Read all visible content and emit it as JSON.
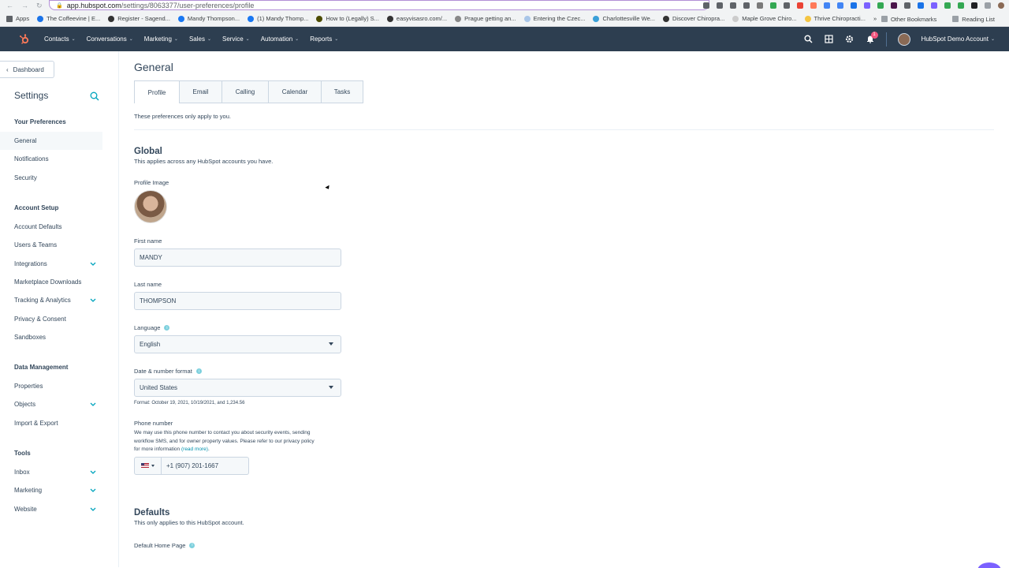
{
  "browser": {
    "url_host": "app.hubspot.com",
    "url_path": "/settings/8063377/user-preferences/profile",
    "bookmarks": [
      {
        "label": "Apps",
        "color": "#5f6368"
      },
      {
        "label": "The Coffeevine | E...",
        "color": "#1a73e8"
      },
      {
        "label": "Register - Sagend...",
        "color": "#333333"
      },
      {
        "label": "Mandy Thompson...",
        "color": "#1877f2"
      },
      {
        "label": "(1) Mandy Thomp...",
        "color": "#1877f2"
      },
      {
        "label": "How to (Legally) S...",
        "color": "#4c4c00"
      },
      {
        "label": "easyvisasro.com/...",
        "color": "#333333"
      },
      {
        "label": "Prague getting an...",
        "color": "#888888"
      },
      {
        "label": "Entering the Czec...",
        "color": "#a9c6e8"
      },
      {
        "label": "Charlottesville We...",
        "color": "#3aa0d8"
      },
      {
        "label": "Discover Chiropra...",
        "color": "#333333"
      },
      {
        "label": "Maple Grove Chiro...",
        "color": "#cccccc"
      },
      {
        "label": "Thrive Chiropracti...",
        "color": "#f4c542"
      }
    ],
    "bookmarks_more": "»",
    "other_bookmarks": "Other Bookmarks",
    "reading_list": "Reading List"
  },
  "nav": {
    "menu": [
      "Contacts",
      "Conversations",
      "Marketing",
      "Sales",
      "Service",
      "Automation",
      "Reports"
    ],
    "notification_count": "1",
    "account_name": "HubSpot Demo Account"
  },
  "sidebar": {
    "dashboard_label": "Dashboard",
    "title": "Settings",
    "sections": [
      {
        "title": "Your Preferences",
        "items": [
          {
            "label": "General",
            "active": true,
            "expandable": false
          },
          {
            "label": "Notifications",
            "active": false,
            "expandable": false
          },
          {
            "label": "Security",
            "active": false,
            "expandable": false
          }
        ]
      },
      {
        "title": "Account Setup",
        "items": [
          {
            "label": "Account Defaults",
            "active": false,
            "expandable": false
          },
          {
            "label": "Users & Teams",
            "active": false,
            "expandable": false
          },
          {
            "label": "Integrations",
            "active": false,
            "expandable": true
          },
          {
            "label": "Marketplace Downloads",
            "active": false,
            "expandable": false
          },
          {
            "label": "Tracking & Analytics",
            "active": false,
            "expandable": true
          },
          {
            "label": "Privacy & Consent",
            "active": false,
            "expandable": false
          },
          {
            "label": "Sandboxes",
            "active": false,
            "expandable": false
          }
        ]
      },
      {
        "title": "Data Management",
        "items": [
          {
            "label": "Properties",
            "active": false,
            "expandable": false
          },
          {
            "label": "Objects",
            "active": false,
            "expandable": true
          },
          {
            "label": "Import & Export",
            "active": false,
            "expandable": false
          }
        ]
      },
      {
        "title": "Tools",
        "items": [
          {
            "label": "Inbox",
            "active": false,
            "expandable": true
          },
          {
            "label": "Marketing",
            "active": false,
            "expandable": true
          },
          {
            "label": "Website",
            "active": false,
            "expandable": true
          }
        ]
      }
    ]
  },
  "content": {
    "title": "General",
    "tabs": [
      "Profile",
      "Email",
      "Calling",
      "Calendar",
      "Tasks"
    ],
    "intro": "These preferences only apply to you.",
    "global": {
      "title": "Global",
      "subtitle": "This applies across any HubSpot accounts you have.",
      "profile_image_label": "Profile Image",
      "first_name_label": "First name",
      "first_name_value": "MANDY",
      "last_name_label": "Last name",
      "last_name_value": "THOMPSON",
      "language_label": "Language",
      "language_value": "English",
      "date_format_label": "Date & number format",
      "date_format_value": "United States",
      "date_format_hint": "Format: October 19, 2021, 10/19/2021, and 1,234.56",
      "phone_label": "Phone number",
      "phone_desc_line1": "We may use this phone number to contact you about security events, sending",
      "phone_desc_line2": "workflow SMS, and for owner property values. Please refer to our privacy policy",
      "phone_desc_line3": "for more information",
      "phone_desc_link": "(read more)",
      "phone_desc_end": ".",
      "phone_value": "+1 (907) 201-1667"
    },
    "defaults": {
      "title": "Defaults",
      "subtitle": "This only applies to this HubSpot account.",
      "home_page_label": "Default Home Page"
    }
  }
}
